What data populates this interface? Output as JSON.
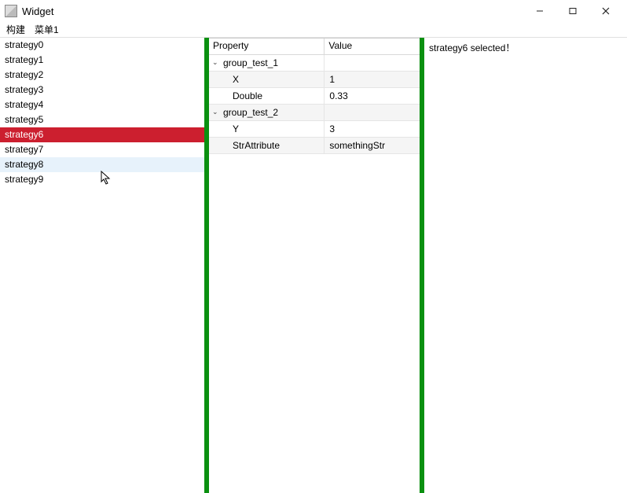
{
  "window": {
    "title": "Widget"
  },
  "menubar": {
    "items": [
      "构建",
      "菜单1"
    ]
  },
  "strategy_list": {
    "items": [
      "strategy0",
      "strategy1",
      "strategy2",
      "strategy3",
      "strategy4",
      "strategy5",
      "strategy6",
      "strategy7",
      "strategy8",
      "strategy9"
    ],
    "selected_index": 6,
    "hover_index": 8
  },
  "property_panel": {
    "header": {
      "property": "Property",
      "value": "Value"
    },
    "groups": [
      {
        "name": "group_test_1",
        "expanded": true,
        "rows": [
          {
            "key": "X",
            "value": "1"
          },
          {
            "key": "Double",
            "value": "0.33"
          }
        ]
      },
      {
        "name": "group_test_2",
        "expanded": true,
        "rows": [
          {
            "key": "Y",
            "value": "3"
          },
          {
            "key": "StrAttribute",
            "value": "somethingStr"
          }
        ]
      }
    ]
  },
  "status_panel": {
    "message": "strategy6 selected！"
  }
}
